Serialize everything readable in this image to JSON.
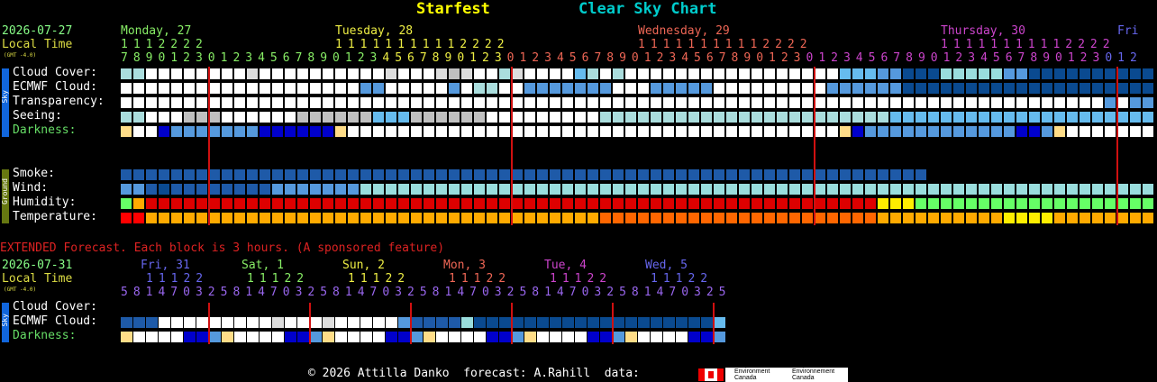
{
  "header": {
    "title_left": "Starfest",
    "title_right": "Clear Sky Chart",
    "title_left_color": "#ffff00",
    "title_right_color": "#00cccc"
  },
  "main": {
    "date": "2026-07-27",
    "local_time_label": "Local Time",
    "gmt_label": "(GMT -4.0)",
    "days": [
      {
        "label": "Monday, 27",
        "color": "#88ee66"
      },
      {
        "label": "Tuesday, 28",
        "color": "#eeee44"
      },
      {
        "label": "Wednesday, 29",
        "color": "#ee6655"
      },
      {
        "label": "Thursday, 30",
        "color": "#cc44cc"
      },
      {
        "label": "Fri",
        "color": "#6666ee"
      }
    ],
    "tens_segments": [
      {
        "text": "1112222",
        "color": "#88ee66"
      },
      {
        "text": "11111111112222",
        "color": "#eeee44"
      },
      {
        "text": "11111111112222",
        "color": "#ee6655"
      },
      {
        "text": "11111111112222",
        "color": "#cc44cc"
      }
    ],
    "hours_segments": [
      {
        "text": "789012301234567890123",
        "color": "#88ee66"
      },
      {
        "text": "4567890123",
        "color": "#eeee44"
      },
      {
        "text": "012345678901234567890123",
        "color": "#ee6655"
      },
      {
        "text": "012345678901234567890123",
        "color": "#cc44cc"
      },
      {
        "text": "012",
        "color": "#6666ee"
      }
    ],
    "sky_label": "Sky",
    "ground_label": "Ground",
    "rows": {
      "cloud_cover": "Cloud Cover:",
      "ecmwf_cloud": "ECMWF Cloud:",
      "transparency": "Transparency:",
      "seeing": "Seeing:",
      "darkness": "Darkness:",
      "smoke": "Smoke:",
      "wind": "Wind:",
      "humidity": "Humidity:",
      "temperature": "Temperature:"
    }
  },
  "extended": {
    "heading": "EXTENDED Forecast. Each block is 3 hours. (A sponsored feature)",
    "date": "2026-07-31",
    "local_time_label": "Local Time",
    "gmt_label": "(GMT -4.0)",
    "days": [
      {
        "label": "Fri, 31",
        "tens": "11122",
        "color": "#6666ee"
      },
      {
        "label": "Sat, 1",
        "tens": "11122",
        "color": "#88ee66"
      },
      {
        "label": "Sun, 2",
        "tens": "11122",
        "color": "#eeee44"
      },
      {
        "label": "Mon, 3",
        "tens": "11122",
        "color": "#ee6655"
      },
      {
        "label": "Tue, 4",
        "tens": "11122",
        "color": "#cc44cc"
      },
      {
        "label": "Wed, 5",
        "tens": "11122",
        "color": "#6666ee"
      }
    ],
    "hours": "5814703258147032581470325814703258147032581470325814703",
    "rows": {
      "cloud_cover": "Cloud Cover:",
      "ecmwf_cloud": "ECMWF Cloud:",
      "darkness": "Darkness:"
    }
  },
  "footer": {
    "text": "© 2026 Attilla Danko  forecast: A.Rahill  data:",
    "logo1": "Environment Canada",
    "logo2": "Environnement Canada"
  },
  "colors": {
    "label_cyan": "#66dd99",
    "date_color": "#88ff88",
    "local_time_color": "#dddd44",
    "darkness_label": "#66dd66",
    "extended_heading": "#dd2222",
    "sky_bar": "#1166dd",
    "ground_bar": "#667711",
    "midnight_line": "#d01010"
  },
  "grid": {
    "cloud_cover": "AAWWWWWWWWWWWWWWWWWWWWWWWWWWWWWWWWWWWWWWWWWWWWWWWWWWWWWWWWWWWWWWWWWWWWWWWWWWWWWWWWWWWWWWWWWWWWWWWWWWWWW",
    "transparency": "WWWWWWWWWWWWWWWWWWWWWWWWWWWWWWWW",
    "note": "cell colour codes used by the script"
  },
  "palette": {
    "W": "#ffffff",
    "L": "#dddddd",
    "G": "#c0c0c0",
    "A": "#aadddd",
    "C": "#99dddd",
    "S": "#66bbee",
    "M": "#5599dd",
    "B": "#1e5aa8",
    "D": "#0a4a90",
    "N": "#003070",
    "K": "#0000cc",
    "Y": "#ffff00",
    "O": "#ffaa00",
    "R": "#ff4400",
    "E": "#ff0000",
    "F": "#dd0000",
    "H": "#ff6600",
    "T": "#66ff66",
    "Q": "#33ffdd",
    "P": "#ffdd88",
    "Z": "#ffee00"
  }
}
